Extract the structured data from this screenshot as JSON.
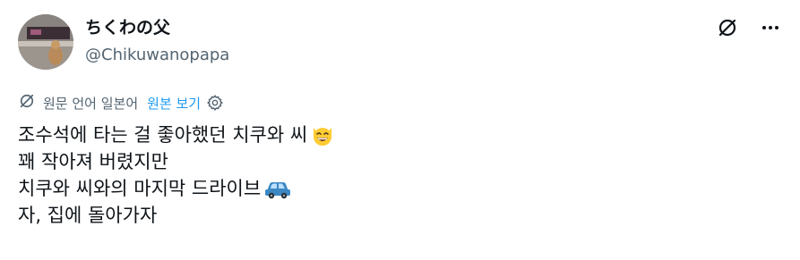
{
  "author": {
    "display_name": "ちくわの父",
    "handle": "@Chikuwanopapa",
    "avatar_icon": "avatar-photo"
  },
  "top_icons": [
    "grok-icon",
    "more-options-icon"
  ],
  "more_label": "···",
  "translation": {
    "icon": "translate-icon",
    "note": "원문 언어 일본어",
    "show_original": "원본 보기",
    "settings_icon": "gear-icon"
  },
  "post": {
    "lines": [
      {
        "text": "조수석에 타는 걸 좋아했던 치쿠와 씨",
        "emoji": "grinning-cat-icon"
      },
      {
        "text": "꽤 작아져 버렸지만",
        "emoji": ""
      },
      {
        "text": "치쿠와 씨와의 마지막 드라이브",
        "emoji": "car-icon"
      },
      {
        "text": "자, 집에 돌아가자",
        "emoji": ""
      }
    ]
  },
  "colors": {
    "text_primary": "#0f1419",
    "text_secondary": "#536471",
    "link": "#1d9bf0"
  }
}
